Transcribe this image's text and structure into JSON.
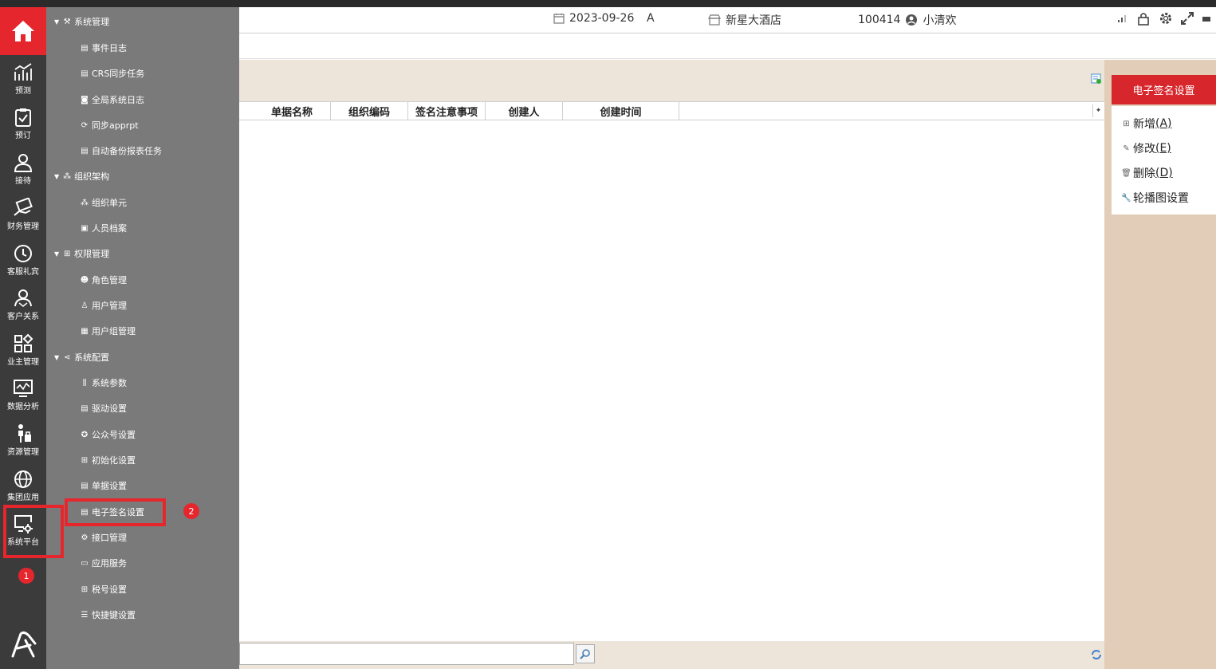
{
  "header": {
    "date": "2023-09-26",
    "shift": "A",
    "hotel": "新星大酒店",
    "user_id": "100414",
    "user_name": "小清欢"
  },
  "rail": {
    "items": [
      {
        "label": "预测"
      },
      {
        "label": "预订"
      },
      {
        "label": "接待"
      },
      {
        "label": "财务管理"
      },
      {
        "label": "客服礼宾"
      },
      {
        "label": "客户关系"
      },
      {
        "label": "业主管理"
      },
      {
        "label": "数据分析"
      },
      {
        "label": "资源管理"
      },
      {
        "label": "集团应用"
      },
      {
        "label": "系统平台"
      }
    ]
  },
  "tree": {
    "groups": [
      {
        "label": "系统管理",
        "items": [
          "事件日志",
          "CRS同步任务",
          "全局系统日志",
          "同步apprpt",
          "自动备份报表任务"
        ]
      },
      {
        "label": "组织架构",
        "items": [
          "组织单元",
          "人员档案"
        ]
      },
      {
        "label": "权限管理",
        "items": [
          "角色管理",
          "用户管理",
          "用户组管理"
        ]
      },
      {
        "label": "系统配置",
        "items": [
          "系统参数",
          "驱动设置",
          "公众号设置",
          "初始化设置",
          "单据设置",
          "电子签名设置",
          "接口管理",
          "应用服务",
          "税号设置",
          "快捷键设置"
        ]
      }
    ]
  },
  "grid": {
    "columns": [
      "单据名称",
      "组织编码",
      "签名注意事项",
      "创建人",
      "创建时间"
    ]
  },
  "right_panel": {
    "title": "电子签名设置",
    "actions": [
      {
        "label": "新增",
        "key": "(A)"
      },
      {
        "label": "修改",
        "key": "(E)"
      },
      {
        "label": "删除",
        "key": "(D)"
      },
      {
        "label": "轮播图设置",
        "key": ""
      }
    ]
  },
  "annotations": {
    "badge1": "1",
    "badge2": "2"
  },
  "colors": {
    "accent_red": "#e5272d",
    "rail_bg": "#3b3b3b",
    "tree_bg": "#7a7a7a",
    "panel_beige": "#ede4da",
    "right_panel_bg": "#e2cdb9"
  }
}
